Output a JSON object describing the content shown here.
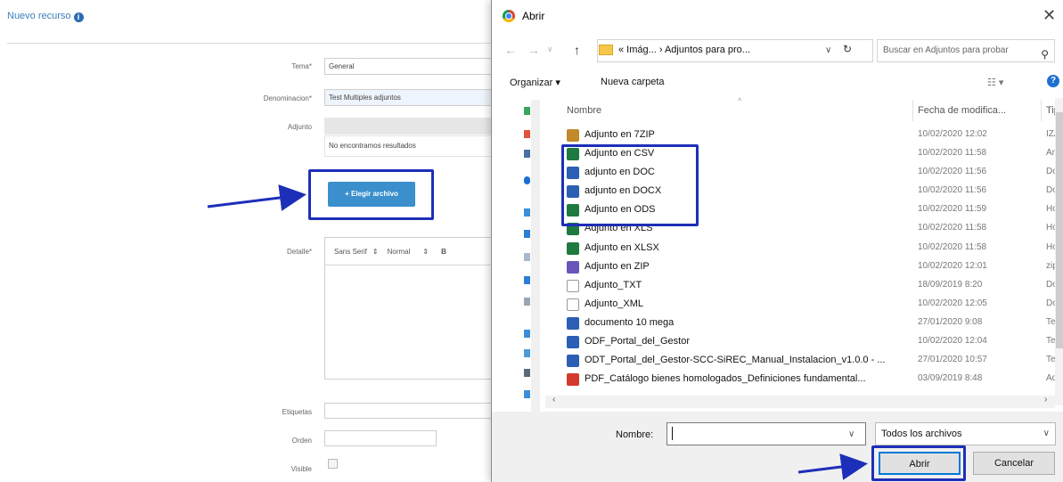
{
  "form": {
    "title": "Nuevo recurso",
    "info_icon_glyph": "i",
    "fields": {
      "tema_label": "Tema*",
      "tema_value": "General",
      "denominacion_label": "Denominacion*",
      "denominacion_value": "Test Multiples adjuntos",
      "adjunto_label": "Adjunto",
      "adjunto_empty": "No encontramos resultados",
      "choose_file": "+ Elegir archivo",
      "detalle_label": "Detalle*",
      "editor_font": "Sans Serif",
      "editor_size": "Normal",
      "editor_bold": "B",
      "etiquetas_label": "Etiquetas",
      "orden_label": "Orden",
      "visible_label": "Visible"
    }
  },
  "dialog": {
    "title": "Abrir",
    "close_glyph": "✕",
    "nav": {
      "back": "←",
      "forward": "→",
      "dropdown": "∨",
      "up": "↑",
      "breadcrumb": "« Imág... › Adjuntos para pro...",
      "refresh": "↻",
      "search_placeholder": "Buscar en Adjuntos para probar",
      "search_glyph": "⚲"
    },
    "toolbar": {
      "organize": "Organizar ▾",
      "new_folder": "Nueva carpeta",
      "view_glyph": "☷ ▾",
      "help_glyph": "?"
    },
    "columns": {
      "name": "Nombre",
      "date": "Fecha de modifica...",
      "type": "Tip"
    },
    "files": [
      {
        "name": "Adjunto en 7ZIP",
        "date": "10/02/2020 12:02",
        "type": "IZA",
        "icon": "archive-icon",
        "color": "#c0892b"
      },
      {
        "name": "Adjunto en CSV",
        "date": "10/02/2020 11:58",
        "type": "Arc",
        "icon": "spreadsheet-icon",
        "color": "#1e7a3e"
      },
      {
        "name": "adjunto en DOC",
        "date": "10/02/2020 11:56",
        "type": "Do",
        "icon": "word-icon",
        "color": "#2b5fb3"
      },
      {
        "name": "adjunto en DOCX",
        "date": "10/02/2020 11:56",
        "type": "Do",
        "icon": "word-icon",
        "color": "#2b5fb3"
      },
      {
        "name": "Adjunto en ODS",
        "date": "10/02/2020 11:59",
        "type": "Ho",
        "icon": "spreadsheet-icon",
        "color": "#1e7a3e"
      },
      {
        "name": "Adjunto en XLS",
        "date": "10/02/2020 11:58",
        "type": "Ho",
        "icon": "excel-icon",
        "color": "#1e7a3e"
      },
      {
        "name": "Adjunto en XLSX",
        "date": "10/02/2020 11:58",
        "type": "Ho",
        "icon": "excel-icon",
        "color": "#1e7a3e"
      },
      {
        "name": "Adjunto en ZIP",
        "date": "10/02/2020 12:01",
        "type": "zip",
        "icon": "zip-icon",
        "color": "#6a55b8"
      },
      {
        "name": "Adjunto_TXT",
        "date": "18/09/2019 8:20",
        "type": "Do",
        "icon": "text-file-icon",
        "color": "#ffffff"
      },
      {
        "name": "Adjunto_XML",
        "date": "10/02/2020 12:05",
        "type": "Do",
        "icon": "text-file-icon",
        "color": "#ffffff"
      },
      {
        "name": "documento 10 mega",
        "date": "27/01/2020 9:08",
        "type": "Tex",
        "icon": "writer-icon",
        "color": "#2b5fb3"
      },
      {
        "name": "ODF_Portal_del_Gestor",
        "date": "10/02/2020 12:04",
        "type": "Tex",
        "icon": "writer-icon",
        "color": "#2b5fb3"
      },
      {
        "name": "ODT_Portal_del_Gestor-SCC-SiREC_Manual_Instalacion_v1.0.0 - ...",
        "date": "27/01/2020 10:57",
        "type": "Tex",
        "icon": "writer-icon",
        "color": "#2b5fb3"
      },
      {
        "name": "PDF_Catálogo bienes homologados_Definiciones fundamental...",
        "date": "03/09/2019 8:48",
        "type": "Ad",
        "icon": "pdf-icon",
        "color": "#d33a2c"
      }
    ],
    "bottom": {
      "name_label": "Nombre:",
      "name_value": "",
      "name_dropdown": "∨",
      "filter": "Todos los archivos",
      "filter_dropdown": "∨",
      "open": "Abrir",
      "cancel": "Cancelar"
    }
  },
  "colors": {
    "highlight": "#1d2fb8",
    "accent_button": "#3a8fcc"
  }
}
